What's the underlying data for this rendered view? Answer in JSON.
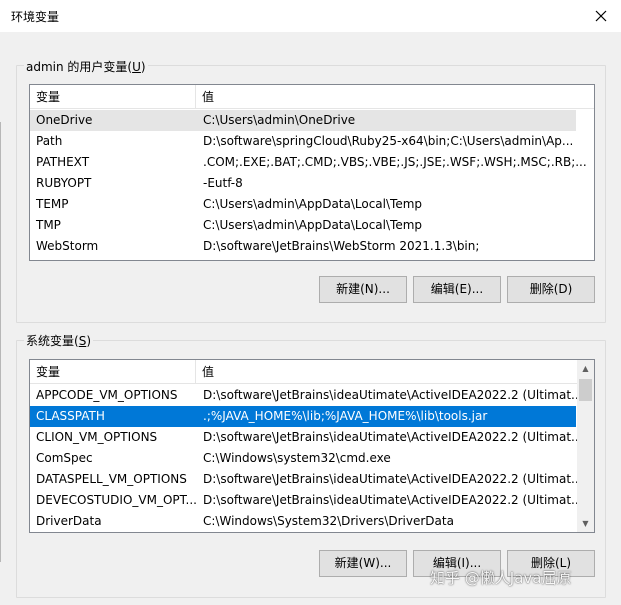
{
  "window": {
    "title": "环境变量",
    "close_glyph": "✕"
  },
  "user_vars": {
    "group_label_prefix": "admin 的用户变量(",
    "group_label_key": "U",
    "group_label_suffix": ")",
    "col_name": "变量",
    "col_value": "值",
    "rows": [
      {
        "name": "OneDrive",
        "value": "C:\\Users\\admin\\OneDrive"
      },
      {
        "name": "Path",
        "value": "D:\\software\\springCloud\\Ruby25-x64\\bin;C:\\Users\\admin\\Ap..."
      },
      {
        "name": "PATHEXT",
        "value": ".COM;.EXE;.BAT;.CMD;.VBS;.VBE;.JS;.JSE;.WSF;.WSH;.MSC;.RB;..."
      },
      {
        "name": "RUBYOPT",
        "value": "-Eutf-8"
      },
      {
        "name": "TEMP",
        "value": "C:\\Users\\admin\\AppData\\Local\\Temp"
      },
      {
        "name": "TMP",
        "value": "C:\\Users\\admin\\AppData\\Local\\Temp"
      },
      {
        "name": "WebStorm",
        "value": "D:\\software\\JetBrains\\WebStorm 2021.1.3\\bin;"
      }
    ],
    "buttons": {
      "new": "新建(N)...",
      "edit": "编辑(E)...",
      "delete": "删除(D)"
    }
  },
  "sys_vars": {
    "group_label_prefix": "系统变量(",
    "group_label_key": "S",
    "group_label_suffix": ")",
    "col_name": "变量",
    "col_value": "值",
    "rows": [
      {
        "name": "APPCODE_VM_OPTIONS",
        "value": "D:\\software\\JetBrains\\ideaUtimate\\ActiveIDEA2022.2 (Ultimat..."
      },
      {
        "name": "CLASSPATH",
        "value": ".;%JAVA_HOME%\\lib;%JAVA_HOME%\\lib\\tools.jar"
      },
      {
        "name": "CLION_VM_OPTIONS",
        "value": "D:\\software\\JetBrains\\ideaUtimate\\ActiveIDEA2022.2 (Ultimat..."
      },
      {
        "name": "ComSpec",
        "value": "C:\\Windows\\system32\\cmd.exe"
      },
      {
        "name": "DATASPELL_VM_OPTIONS",
        "value": "D:\\software\\JetBrains\\ideaUtimate\\ActiveIDEA2022.2 (Ultimat..."
      },
      {
        "name": "DEVECOSTUDIO_VM_OPT...",
        "value": "D:\\software\\JetBrains\\ideaUtimate\\ActiveIDEA2022.2 (Ultimat..."
      },
      {
        "name": "DriverData",
        "value": "C:\\Windows\\System32\\Drivers\\DriverData"
      }
    ],
    "buttons": {
      "new": "新建(W)...",
      "edit": "编辑(I)...",
      "delete": "删除(L)"
    }
  },
  "watermark": "知乎 @懒人Java屈原",
  "colors": {
    "selection": "#0078d7",
    "hover_row": "#e5e5e5",
    "dialog_bg": "#f0f0f0"
  }
}
